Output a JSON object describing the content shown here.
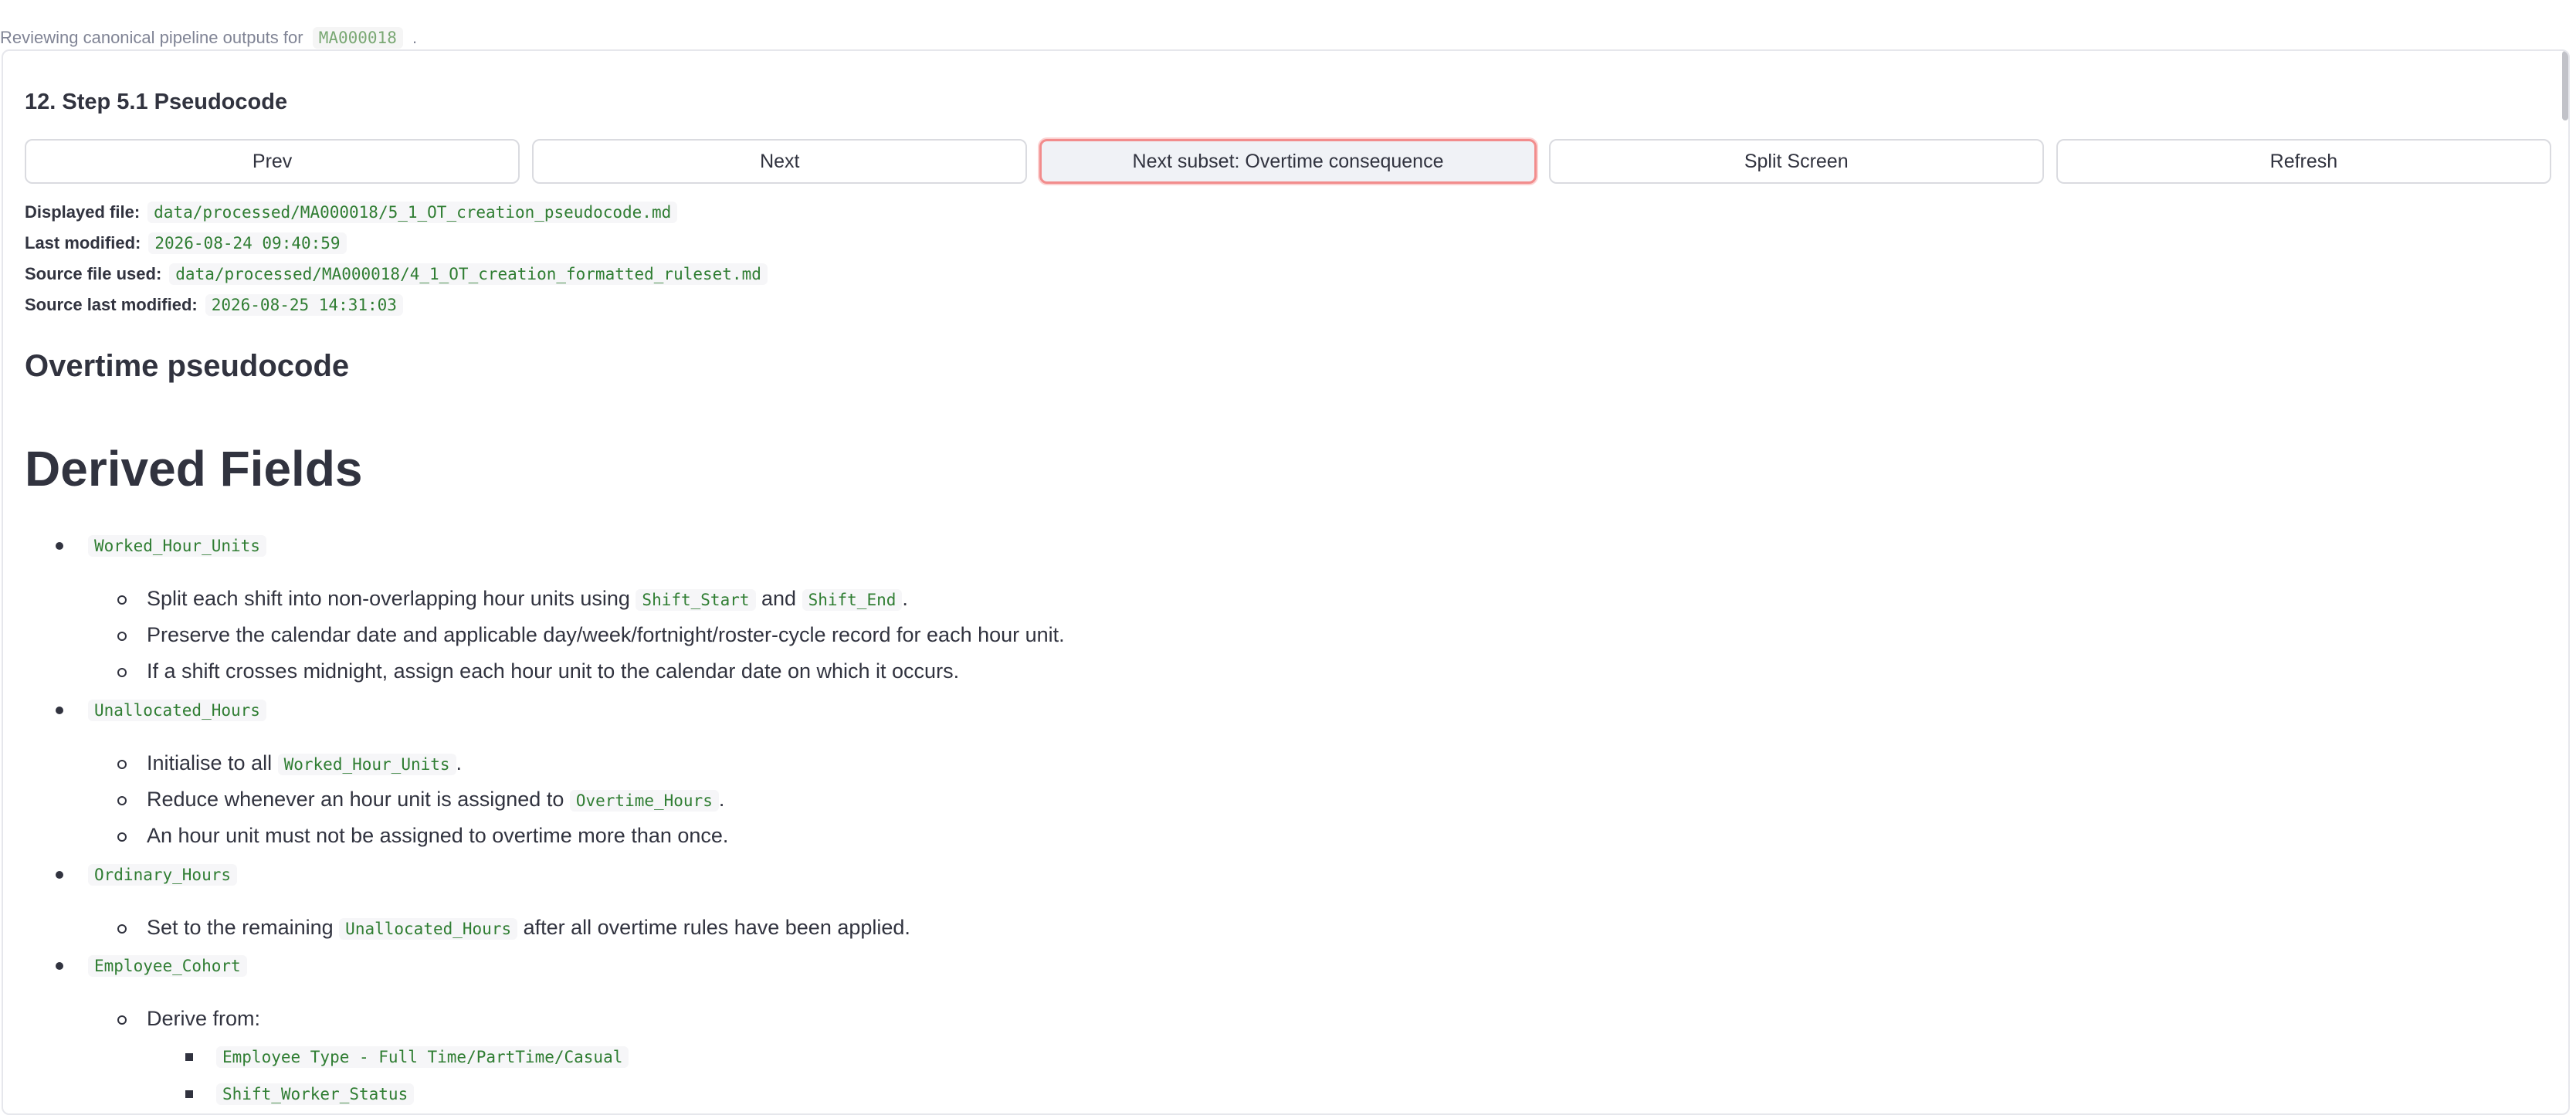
{
  "header": {
    "prefix": "Reviewing canonical pipeline outputs for",
    "id": "MA000018",
    "suffix": "."
  },
  "step_title": "12. Step 5.1 Pseudocode",
  "buttons": {
    "prev": "Prev",
    "next": "Next",
    "next_subset": "Next subset: Overtime consequence",
    "split_screen": "Split Screen",
    "refresh": "Refresh"
  },
  "meta": {
    "displayed_file_label": "Displayed file:",
    "displayed_file": "data/processed/MA000018/5_1_OT_creation_pseudocode.md",
    "last_modified_label": "Last modified:",
    "last_modified": "2026-08-24 09:40:59",
    "source_file_label": "Source file used:",
    "source_file": "data/processed/MA000018/4_1_OT_creation_formatted_ruleset.md",
    "source_last_modified_label": "Source last modified:",
    "source_last_modified": "2026-08-25 14:31:03"
  },
  "doc": {
    "h3": "Overtime pseudocode",
    "h1": "Derived Fields",
    "worked_hour_units": "Worked_Hour_Units",
    "whu_1_a": "Split each shift into non-overlapping hour units using",
    "whu_1_code1": "Shift_Start",
    "whu_1_and": "and",
    "whu_1_code2": "Shift_End",
    "whu_1_end": ".",
    "whu_2": "Preserve the calendar date and applicable day/week/fortnight/roster-cycle record for each hour unit.",
    "whu_3": "If a shift crosses midnight, assign each hour unit to the calendar date on which it occurs.",
    "unallocated_hours": "Unallocated_Hours",
    "uh_1_a": "Initialise to all",
    "uh_1_code": "Worked_Hour_Units",
    "uh_1_end": ".",
    "uh_2_a": "Reduce whenever an hour unit is assigned to",
    "uh_2_code": "Overtime_Hours",
    "uh_2_end": ".",
    "uh_3": "An hour unit must not be assigned to overtime more than once.",
    "ordinary_hours": "Ordinary_Hours",
    "oh_1_a": "Set to the remaining",
    "oh_1_code": "Unallocated_Hours",
    "oh_1_end": "after all overtime rules have been applied.",
    "employee_cohort": "Employee_Cohort",
    "ec_1": "Derive from:",
    "ec_1_a": "Employee Type - Full Time/PartTime/Casual",
    "ec_1_b": "Shift_Worker_Status"
  }
}
